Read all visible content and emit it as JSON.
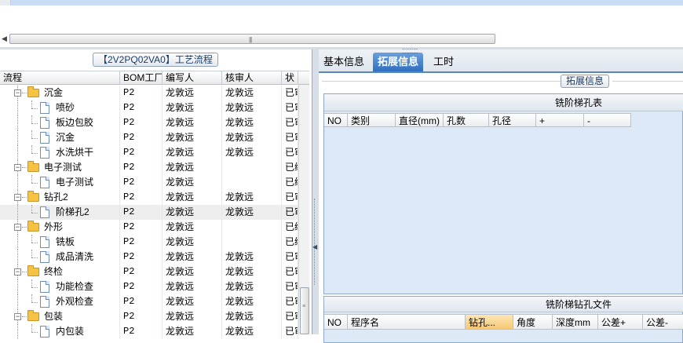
{
  "left_panel": {
    "title": "【2V2PQ02VA0】工艺流程",
    "columns": [
      "流程",
      "BOM工厂",
      "编写人",
      "核审人",
      "状"
    ],
    "rows": [
      {
        "level": 1,
        "type": "folder",
        "name": "沉金",
        "bom": "P2",
        "writer": "龙敦远",
        "reviewer": "龙敦远",
        "status": "已审"
      },
      {
        "level": 2,
        "type": "doc",
        "name": "喷砂",
        "bom": "P2",
        "writer": "龙敦远",
        "reviewer": "龙敦远",
        "status": "已审"
      },
      {
        "level": 2,
        "type": "doc",
        "name": "板边包胶",
        "bom": "P2",
        "writer": "龙敦远",
        "reviewer": "龙敦远",
        "status": "已审"
      },
      {
        "level": 2,
        "type": "doc",
        "name": "沉金",
        "bom": "P2",
        "writer": "龙敦远",
        "reviewer": "龙敦远",
        "status": "已审"
      },
      {
        "level": 2,
        "type": "doc",
        "name": "水洗烘干",
        "bom": "P2",
        "writer": "龙敦远",
        "reviewer": "龙敦远",
        "status": "已审"
      },
      {
        "level": 1,
        "type": "folder",
        "name": "电子测试",
        "bom": "P2",
        "writer": "龙敦远",
        "reviewer": "",
        "status": "已编"
      },
      {
        "level": 2,
        "type": "doc",
        "name": "电子测试",
        "bom": "P2",
        "writer": "龙敦远",
        "reviewer": "",
        "status": "已编"
      },
      {
        "level": 1,
        "type": "folder",
        "name": "钻孔2",
        "bom": "P2",
        "writer": "龙敦远",
        "reviewer": "龙敦远",
        "status": "已审"
      },
      {
        "level": 2,
        "type": "doc",
        "name": "阶梯孔2",
        "bom": "P2",
        "writer": "龙敦远",
        "reviewer": "龙敦远",
        "status": "已审",
        "selected": true
      },
      {
        "level": 1,
        "type": "folder",
        "name": "外形",
        "bom": "P2",
        "writer": "龙敦远",
        "reviewer": "",
        "status": "已编"
      },
      {
        "level": 2,
        "type": "doc",
        "name": "铣板",
        "bom": "P2",
        "writer": "龙敦远",
        "reviewer": "",
        "status": "已编"
      },
      {
        "level": 2,
        "type": "doc",
        "name": "成品清洗",
        "bom": "P2",
        "writer": "龙敦远",
        "reviewer": "龙敦远",
        "status": "已审"
      },
      {
        "level": 1,
        "type": "folder",
        "name": "终检",
        "bom": "P2",
        "writer": "龙敦远",
        "reviewer": "龙敦远",
        "status": "已审"
      },
      {
        "level": 2,
        "type": "doc",
        "name": "功能检查",
        "bom": "P2",
        "writer": "龙敦远",
        "reviewer": "龙敦远",
        "status": "已审"
      },
      {
        "level": 2,
        "type": "doc",
        "name": "外观检查",
        "bom": "P2",
        "writer": "龙敦远",
        "reviewer": "龙敦远",
        "status": "已审"
      },
      {
        "level": 1,
        "type": "folder",
        "name": "包装",
        "bom": "P2",
        "writer": "龙敦远",
        "reviewer": "龙敦远",
        "status": "已审"
      },
      {
        "level": 2,
        "type": "doc",
        "name": "内包装",
        "bom": "P2",
        "writer": "龙敦远",
        "reviewer": "龙敦远",
        "status": "已审"
      }
    ]
  },
  "tabs": [
    {
      "label": "基本信息",
      "active": false
    },
    {
      "label": "拓展信息",
      "active": true
    },
    {
      "label": "工时",
      "active": false
    }
  ],
  "extended": {
    "group_label": "拓展信息",
    "table1": {
      "title": "铣阶梯孔表",
      "columns": [
        "NO",
        "类别",
        "直径(mm)",
        "孔数",
        "孔径",
        "+",
        "-"
      ]
    },
    "table2": {
      "title": "铣阶梯钻孔文件",
      "columns": [
        "NO",
        "程序名",
        "钻孔...",
        "角度",
        "深度mm",
        "公差+",
        "公差-"
      ]
    }
  },
  "icons": {
    "scroll_left": "arrow-left-icon",
    "splitter": "collapse-arrow-icon"
  }
}
